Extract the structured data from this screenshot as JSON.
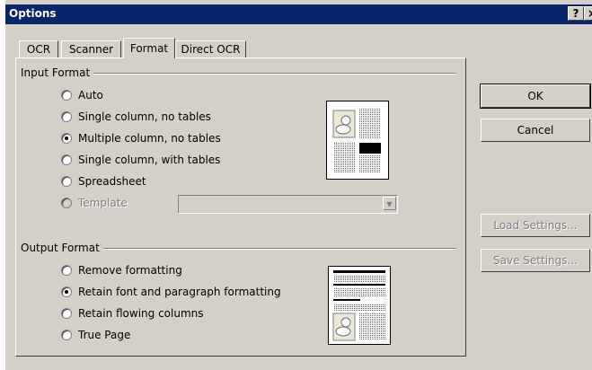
{
  "window": {
    "title": "Options",
    "help_label": "?",
    "close_label": "×"
  },
  "tabs": [
    {
      "label": "OCR",
      "active": false
    },
    {
      "label": "Scanner",
      "active": false
    },
    {
      "label": "Format",
      "active": true
    },
    {
      "label": "Direct OCR",
      "active": false
    }
  ],
  "input_format": {
    "label": "Input Format",
    "options": [
      {
        "label": "Auto",
        "checked": false,
        "enabled": true
      },
      {
        "label": "Single column, no tables",
        "checked": false,
        "enabled": true
      },
      {
        "label": "Multiple column, no tables",
        "checked": true,
        "enabled": true
      },
      {
        "label": "Single column, with tables",
        "checked": false,
        "enabled": true
      },
      {
        "label": "Spreadsheet",
        "checked": false,
        "enabled": true
      },
      {
        "label": "Template",
        "checked": false,
        "enabled": false
      }
    ],
    "template_value": ""
  },
  "output_format": {
    "label": "Output Format",
    "options": [
      {
        "label": "Remove formatting",
        "checked": false,
        "enabled": true
      },
      {
        "label": "Retain font and paragraph formatting",
        "checked": true,
        "enabled": true
      },
      {
        "label": "Retain flowing columns",
        "checked": false,
        "enabled": true
      },
      {
        "label": "True Page",
        "checked": false,
        "enabled": true
      }
    ]
  },
  "buttons": {
    "ok": "OK",
    "cancel": "Cancel",
    "load_settings": "Load Settings...",
    "save_settings": "Save Settings..."
  },
  "icons": {
    "preview_in": "document-layout-preview-icon",
    "preview_out": "document-layout-preview-icon"
  },
  "colors": {
    "face": "#d4d0c8",
    "titlebar": "#0a246a"
  }
}
